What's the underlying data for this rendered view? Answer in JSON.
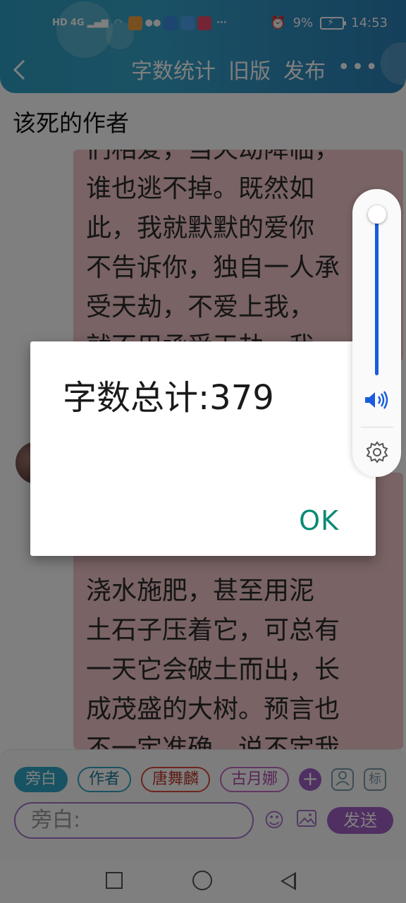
{
  "status_bar": {
    "network_hd": "HD",
    "network_gen": "4G",
    "battery_percent": "9%",
    "time": "14:53",
    "more_indicator": "···"
  },
  "header": {
    "back_icon": "chevron-left-icon",
    "actions": [
      "字数统计",
      "旧版",
      "发布"
    ],
    "more_icon": "more-dots-icon"
  },
  "chapter": {
    "title": "该死的作者"
  },
  "messages": [
    {
      "role": "narration",
      "lines": [
        "们相爱，当天劫降临，",
        "谁也逃不掉。既然如",
        "此，我就默默的爱你",
        "不告诉你，独自一人承",
        "受天劫，不爱上我，",
        "就不用承受天劫。我"
      ]
    },
    {
      "role": "narration",
      "lines": [
        "浇水施肥，甚至用泥",
        "土石子压着它，可总有",
        "一天它会破土而出，长",
        "成茂盛的大树。预言也",
        "不一定准确，说不定我"
      ]
    }
  ],
  "composer": {
    "roles": [
      "旁白",
      "作者",
      "唐舞麟",
      "古月娜"
    ],
    "add_label": "+",
    "icon_person": "person-icon",
    "icon_tag_label": "标",
    "input_placeholder": "旁白:",
    "send_label": "发送"
  },
  "dialog": {
    "message": "字数总计:379",
    "ok_label": "OK"
  },
  "volume": {
    "level": 0.95
  },
  "colors": {
    "header": "#2e9fc4",
    "bubble": "#f2c7c9",
    "accent_purple": "#a15fc5",
    "ok_teal": "#0a8a74",
    "volume_blue": "#1a5cdb"
  }
}
